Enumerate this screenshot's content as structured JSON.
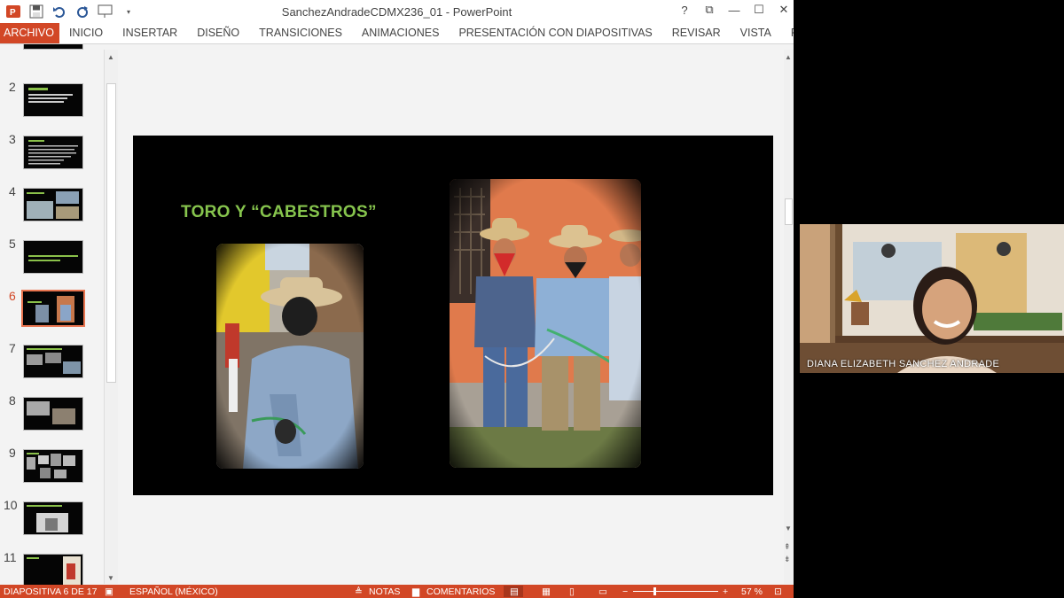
{
  "window": {
    "title": "SanchezAndradeCDMX236_01 - PowerPoint",
    "controls": [
      "?",
      "⧉",
      "—",
      "☐",
      "✕"
    ]
  },
  "ribbon": {
    "tabs": [
      "ARCHIVO",
      "INICIO",
      "INSERTAR",
      "DISEÑO",
      "TRANSICIONES",
      "ANIMACIONES",
      "PRESENTACIÓN CON DIAPOSITIVAS",
      "REVISAR",
      "VISTA",
      "FOXIT READER"
    ]
  },
  "thumbnails": {
    "numbers": [
      "2",
      "3",
      "4",
      "5",
      "6",
      "7",
      "8",
      "9",
      "10",
      "11"
    ],
    "active": "6"
  },
  "slide": {
    "title": "TORO Y “CABESTROS”"
  },
  "status": {
    "slide_info": "DIAPOSITIVA 6 DE 17",
    "language": "ESPAÑOL (MÉXICO)",
    "notes": "NOTAS",
    "comments": "COMENTARIOS",
    "zoom": "57 %"
  },
  "webcam": {
    "name": "DIANA ELIZABETH SANCHEZ ANDRADE"
  },
  "colors": {
    "accent": "#d24726",
    "slide_title": "#86c44d"
  }
}
